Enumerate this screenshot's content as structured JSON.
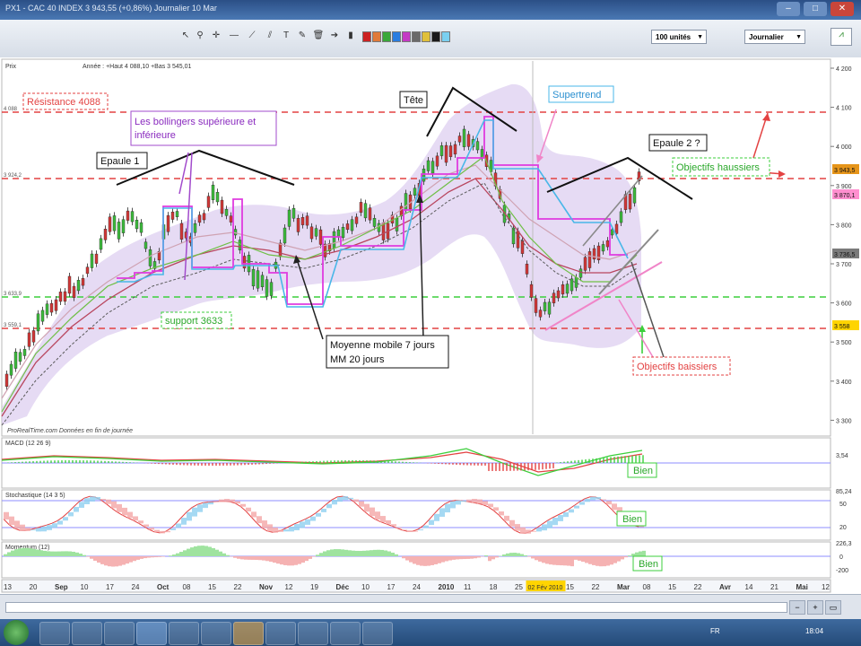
{
  "window": {
    "title": "PX1 - CAC 40 INDEX  3 943,55 (+0,86%)  Journalier 10 Mar",
    "controls": [
      "–",
      "□",
      "✕"
    ]
  },
  "toolbar": {
    "units_select": "100 unités",
    "period_select": "Journalier",
    "tools": [
      "pointer-icon",
      "zoom-icon",
      "crosshair-icon",
      "line-icon",
      "trend-icon",
      "channel-icon",
      "text-icon",
      "delete-icon",
      "arrow-icon",
      "marker-icon"
    ],
    "colors": [
      "#cc2222",
      "#e07a3a",
      "#3aa83a",
      "#2a7de0",
      "#c43ac4",
      "#6a6a6a",
      "#e0c03a",
      "#1a1a1a",
      "#7ad0f0"
    ]
  },
  "price_panel": {
    "label": "Prix",
    "info": "Année : +Haut 4 088,10 +Bas 3 545,01",
    "source": "ProRealTime.com  Données en fin de journée",
    "y_axis_ticks": [
      "4 200",
      "4 100",
      "4 000",
      "3 900",
      "3 800",
      "3 700",
      "3 600",
      "3 500",
      "3 400",
      "3 300"
    ],
    "left_levels": [
      "4 088",
      "3 924,2",
      "3 633,9",
      "3 559,1"
    ],
    "right_badges": [
      "3 943,5",
      "3 870,1",
      "3 736,5",
      "3 558"
    ],
    "badge_colors": [
      "#e6951a",
      "#ff8fcf",
      "#7a7a7a",
      "#ffd400"
    ],
    "annotations": {
      "resistance": "Résistance 4088",
      "bollinger": "Les bollingers supérieure et inférieure",
      "shoulder1": "Epaule 1",
      "head": "Tête",
      "supertrend": "Supertrend",
      "shoulder2": "Epaule 2 ?",
      "objectives_up": "Objectifs haussiers",
      "support": "support 3633",
      "ma_line1": "Moyenne mobile 7 jours",
      "ma_line2": "MM 20 jours",
      "objectives_down": "Objectifs baissiers"
    }
  },
  "macd_panel": {
    "label": "MACD (12 26 9)",
    "badge": "Bien",
    "axis": [
      "3,54"
    ]
  },
  "stoch_panel": {
    "label": "Stochastique (14 3 5)",
    "badge": "Bien",
    "axis": [
      "85,24",
      "50",
      "20"
    ]
  },
  "momentum_panel": {
    "label": "Momentum (12)",
    "badge": "Bien",
    "axis": [
      "0",
      "-200"
    ],
    "value": "226,3"
  },
  "x_axis": {
    "labels": [
      "13",
      "20",
      "Sep",
      "10",
      "17",
      "24",
      "Oct",
      "08",
      "15",
      "22",
      "Nov",
      "12",
      "19",
      "Déc",
      "10",
      "17",
      "24",
      "2010",
      "11",
      "18",
      "25",
      "02 Fév 2010",
      "15",
      "22",
      "Mar",
      "08",
      "15",
      "22",
      "Avr",
      "14",
      "21",
      "Mai",
      "12"
    ]
  },
  "taskbar": {
    "clock": "18:04",
    "lang": "FR"
  }
}
